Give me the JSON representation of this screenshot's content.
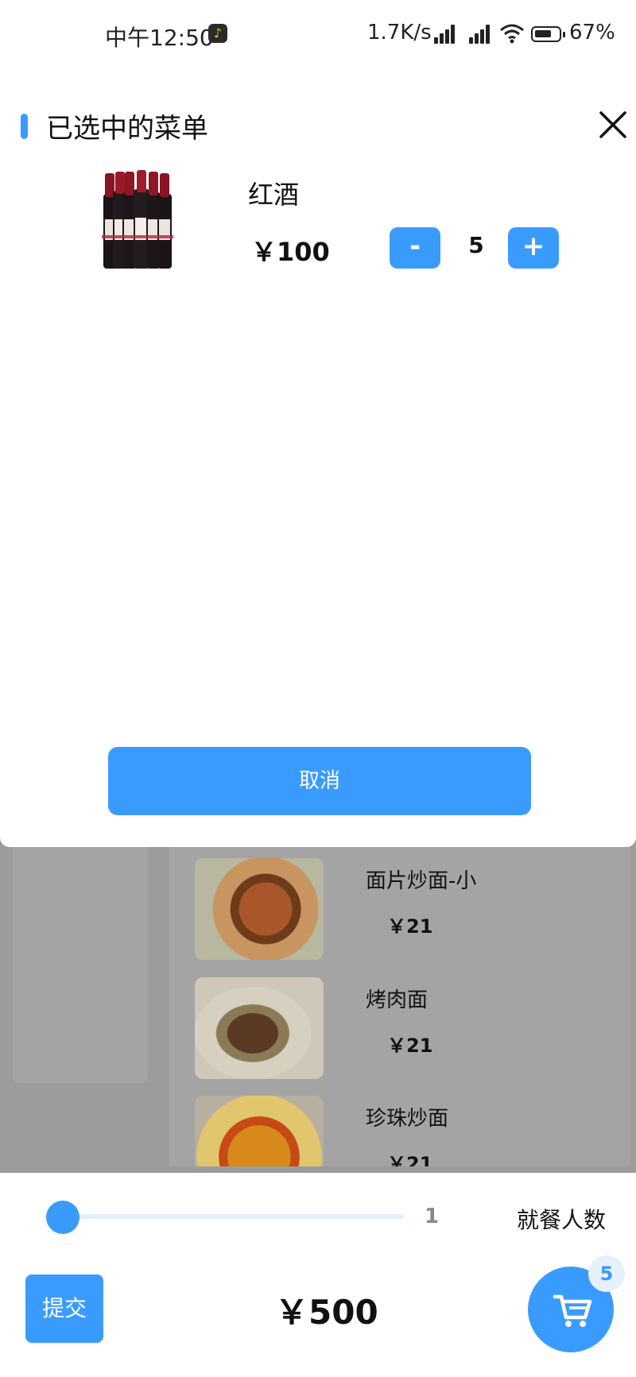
{
  "status_bar": {
    "time": "中午12:50",
    "net_speed": "1.7K/s",
    "battery": "67%"
  },
  "sheet": {
    "title": "已选中的菜单",
    "items": [
      {
        "name": "红酒",
        "price": "￥100",
        "quantity": "5",
        "minus_label": "-",
        "plus_label": "+"
      }
    ],
    "cancel_label": "取消"
  },
  "menu": {
    "items": [
      {
        "name": "面片炒面-小",
        "price": "￥21"
      },
      {
        "name": "烤肉面",
        "price": "￥21"
      },
      {
        "name": "珍珠炒面",
        "price": "￥21"
      }
    ]
  },
  "bottom": {
    "diners_value": "1",
    "diners_label": "就餐人数",
    "submit_label": "提交",
    "total": "￥500",
    "cart_count": "5"
  },
  "colors": {
    "accent": "#3a9bff",
    "overlay": "#9c9c9c"
  }
}
